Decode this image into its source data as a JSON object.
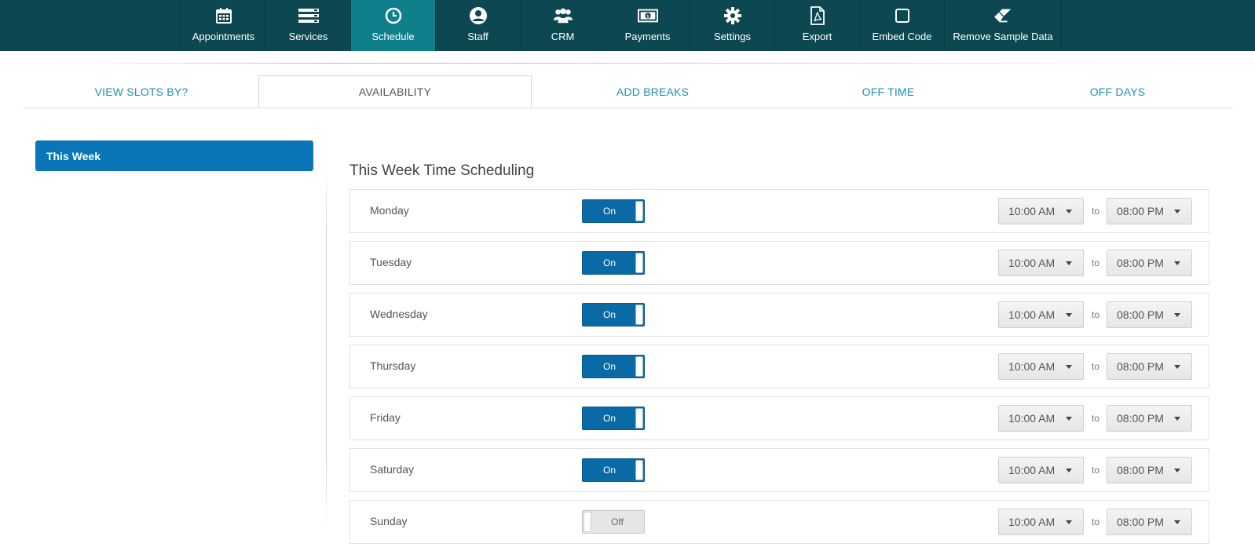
{
  "nav": [
    {
      "label": "Appointments",
      "icon": "calendar-icon",
      "active": false
    },
    {
      "label": "Services",
      "icon": "services-list-icon",
      "active": false
    },
    {
      "label": "Schedule",
      "icon": "clock-icon",
      "active": true
    },
    {
      "label": "Staff",
      "icon": "user-icon",
      "active": false
    },
    {
      "label": "CRM",
      "icon": "users-group-icon",
      "active": false
    },
    {
      "label": "Payments",
      "icon": "money-icon",
      "active": false
    },
    {
      "label": "Settings",
      "icon": "gear-icon",
      "active": false
    },
    {
      "label": "Export",
      "icon": "pdf-file-icon",
      "active": false
    },
    {
      "label": "Embed Code",
      "icon": "square-icon",
      "active": false
    },
    {
      "label": "Remove Sample Data",
      "icon": "eraser-icon",
      "active": false
    }
  ],
  "tabs": [
    {
      "label": "VIEW SLOTS BY?",
      "active": false
    },
    {
      "label": "AVAILABILITY",
      "active": true
    },
    {
      "label": "ADD BREAKS",
      "active": false
    },
    {
      "label": "OFF TIME",
      "active": false
    },
    {
      "label": "OFF DAYS",
      "active": false
    }
  ],
  "sidebar": {
    "items": [
      {
        "label": "This Week",
        "active": true
      }
    ]
  },
  "schedule": {
    "title": "This Week Time Scheduling",
    "to_label": "to",
    "days": [
      {
        "name": "Monday",
        "toggle": "On",
        "enabled": true,
        "from": "10:00 AM",
        "to": "08:00 PM"
      },
      {
        "name": "Tuesday",
        "toggle": "On",
        "enabled": true,
        "from": "10:00 AM",
        "to": "08:00 PM"
      },
      {
        "name": "Wednesday",
        "toggle": "On",
        "enabled": true,
        "from": "10:00 AM",
        "to": "08:00 PM"
      },
      {
        "name": "Thursday",
        "toggle": "On",
        "enabled": true,
        "from": "10:00 AM",
        "to": "08:00 PM"
      },
      {
        "name": "Friday",
        "toggle": "On",
        "enabled": true,
        "from": "10:00 AM",
        "to": "08:00 PM"
      },
      {
        "name": "Saturday",
        "toggle": "On",
        "enabled": true,
        "from": "10:00 AM",
        "to": "08:00 PM"
      },
      {
        "name": "Sunday",
        "toggle": "Off",
        "enabled": false,
        "from": "10:00 AM",
        "to": "08:00 PM"
      }
    ]
  },
  "colors": {
    "topbar": "#0d4852",
    "active_nav": "#0f7f8c",
    "accent": "#0a76b8",
    "tab_link": "#1e8fb3"
  }
}
